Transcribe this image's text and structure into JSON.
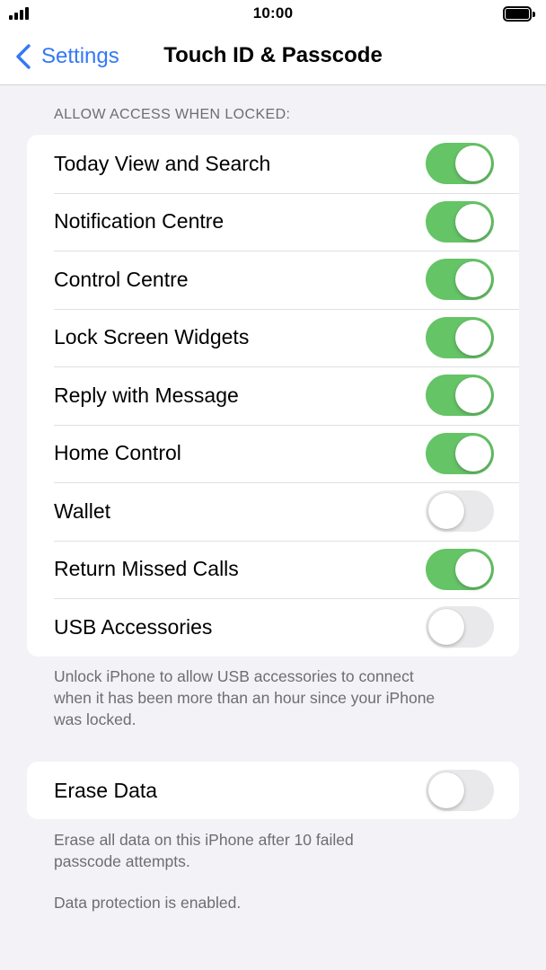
{
  "status_bar": {
    "time": "10:00",
    "signal_icon": "signal-bars-icon",
    "battery_icon": "battery-full-icon"
  },
  "nav": {
    "back_label": "Settings",
    "back_icon": "chevron-left-icon",
    "title": "Touch ID & Passcode"
  },
  "allow_access": {
    "header": "ALLOW ACCESS WHEN LOCKED:",
    "items": [
      {
        "label": "Today View and Search",
        "on": true
      },
      {
        "label": "Notification Centre",
        "on": true
      },
      {
        "label": "Control Centre",
        "on": true
      },
      {
        "label": "Lock Screen Widgets",
        "on": true
      },
      {
        "label": "Reply with Message",
        "on": true
      },
      {
        "label": "Home Control",
        "on": true
      },
      {
        "label": "Wallet",
        "on": false
      },
      {
        "label": "Return Missed Calls",
        "on": true
      },
      {
        "label": "USB Accessories",
        "on": false
      }
    ],
    "footer_lines": [
      "Unlock iPhone to allow USB accessories to connect",
      "when it has been more than an hour since your iPhone",
      "was locked."
    ]
  },
  "erase": {
    "label": "Erase Data",
    "on": false,
    "footer_lines": [
      "Erase all data on this iPhone after 10 failed",
      "passcode attempts."
    ],
    "protection_text": "Data protection is enabled."
  },
  "colors": {
    "accent": "#3478f6",
    "toggle_on": "#65c466",
    "toggle_off": "#e9e9eb",
    "background": "#f2f2f7"
  }
}
